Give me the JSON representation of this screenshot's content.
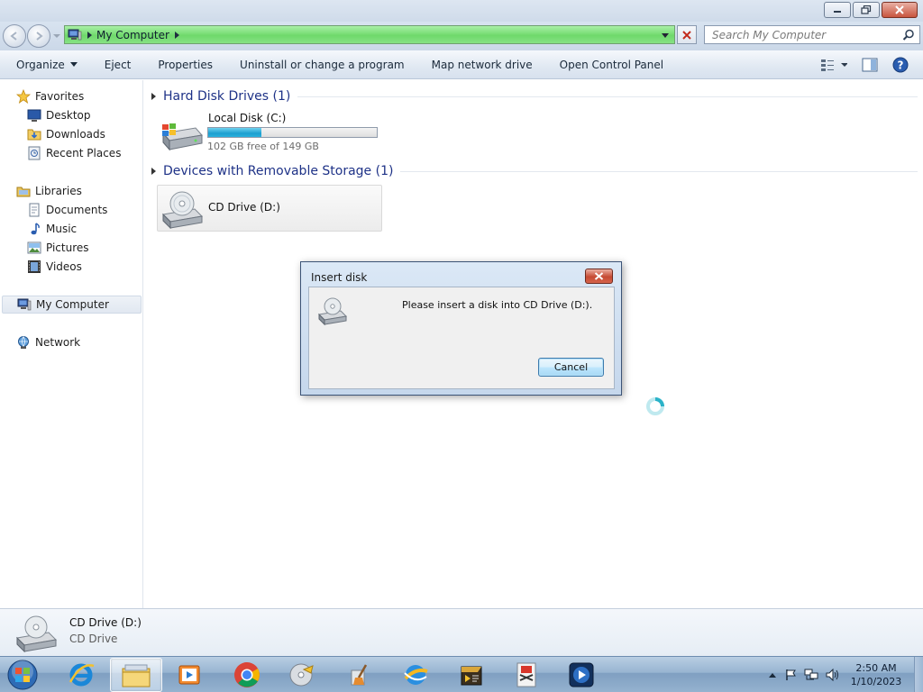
{
  "window": {
    "minimize_label": "minimize",
    "restore_label": "restore",
    "close_label": "close"
  },
  "address": {
    "path": "My Computer",
    "search_placeholder": "Search My Computer"
  },
  "toolbar": {
    "organize": "Organize",
    "eject": "Eject",
    "properties": "Properties",
    "uninstall": "Uninstall or change a program",
    "map_drive": "Map network drive",
    "control_panel": "Open Control Panel"
  },
  "sidebar": {
    "favorites": "Favorites",
    "desktop": "Desktop",
    "downloads": "Downloads",
    "recent": "Recent Places",
    "libraries": "Libraries",
    "documents": "Documents",
    "music": "Music",
    "pictures": "Pictures",
    "videos": "Videos",
    "computer": "My Computer",
    "network": "Network"
  },
  "content": {
    "hdd_group": "Hard Disk Drives (1)",
    "local_disk_name": "Local Disk (C:)",
    "local_disk_free": "102 GB free of 149 GB",
    "local_disk_used_fraction": 0.315,
    "removable_group": "Devices with Removable Storage (1)",
    "cd_drive_name": "CD Drive (D:)"
  },
  "details": {
    "name": "CD Drive (D:)",
    "type": "CD Drive"
  },
  "dialog": {
    "title": "Insert disk",
    "message": "Please insert a disk into CD Drive (D:).",
    "cancel": "Cancel"
  },
  "taskbar": {
    "time": "2:50 AM",
    "date": "1/10/2023"
  },
  "colors": {
    "address_bar": "#6fd96b",
    "usage_fill": "#1c9fd0",
    "group_header": "#1e3287",
    "taskbar": "#97b4d1"
  }
}
